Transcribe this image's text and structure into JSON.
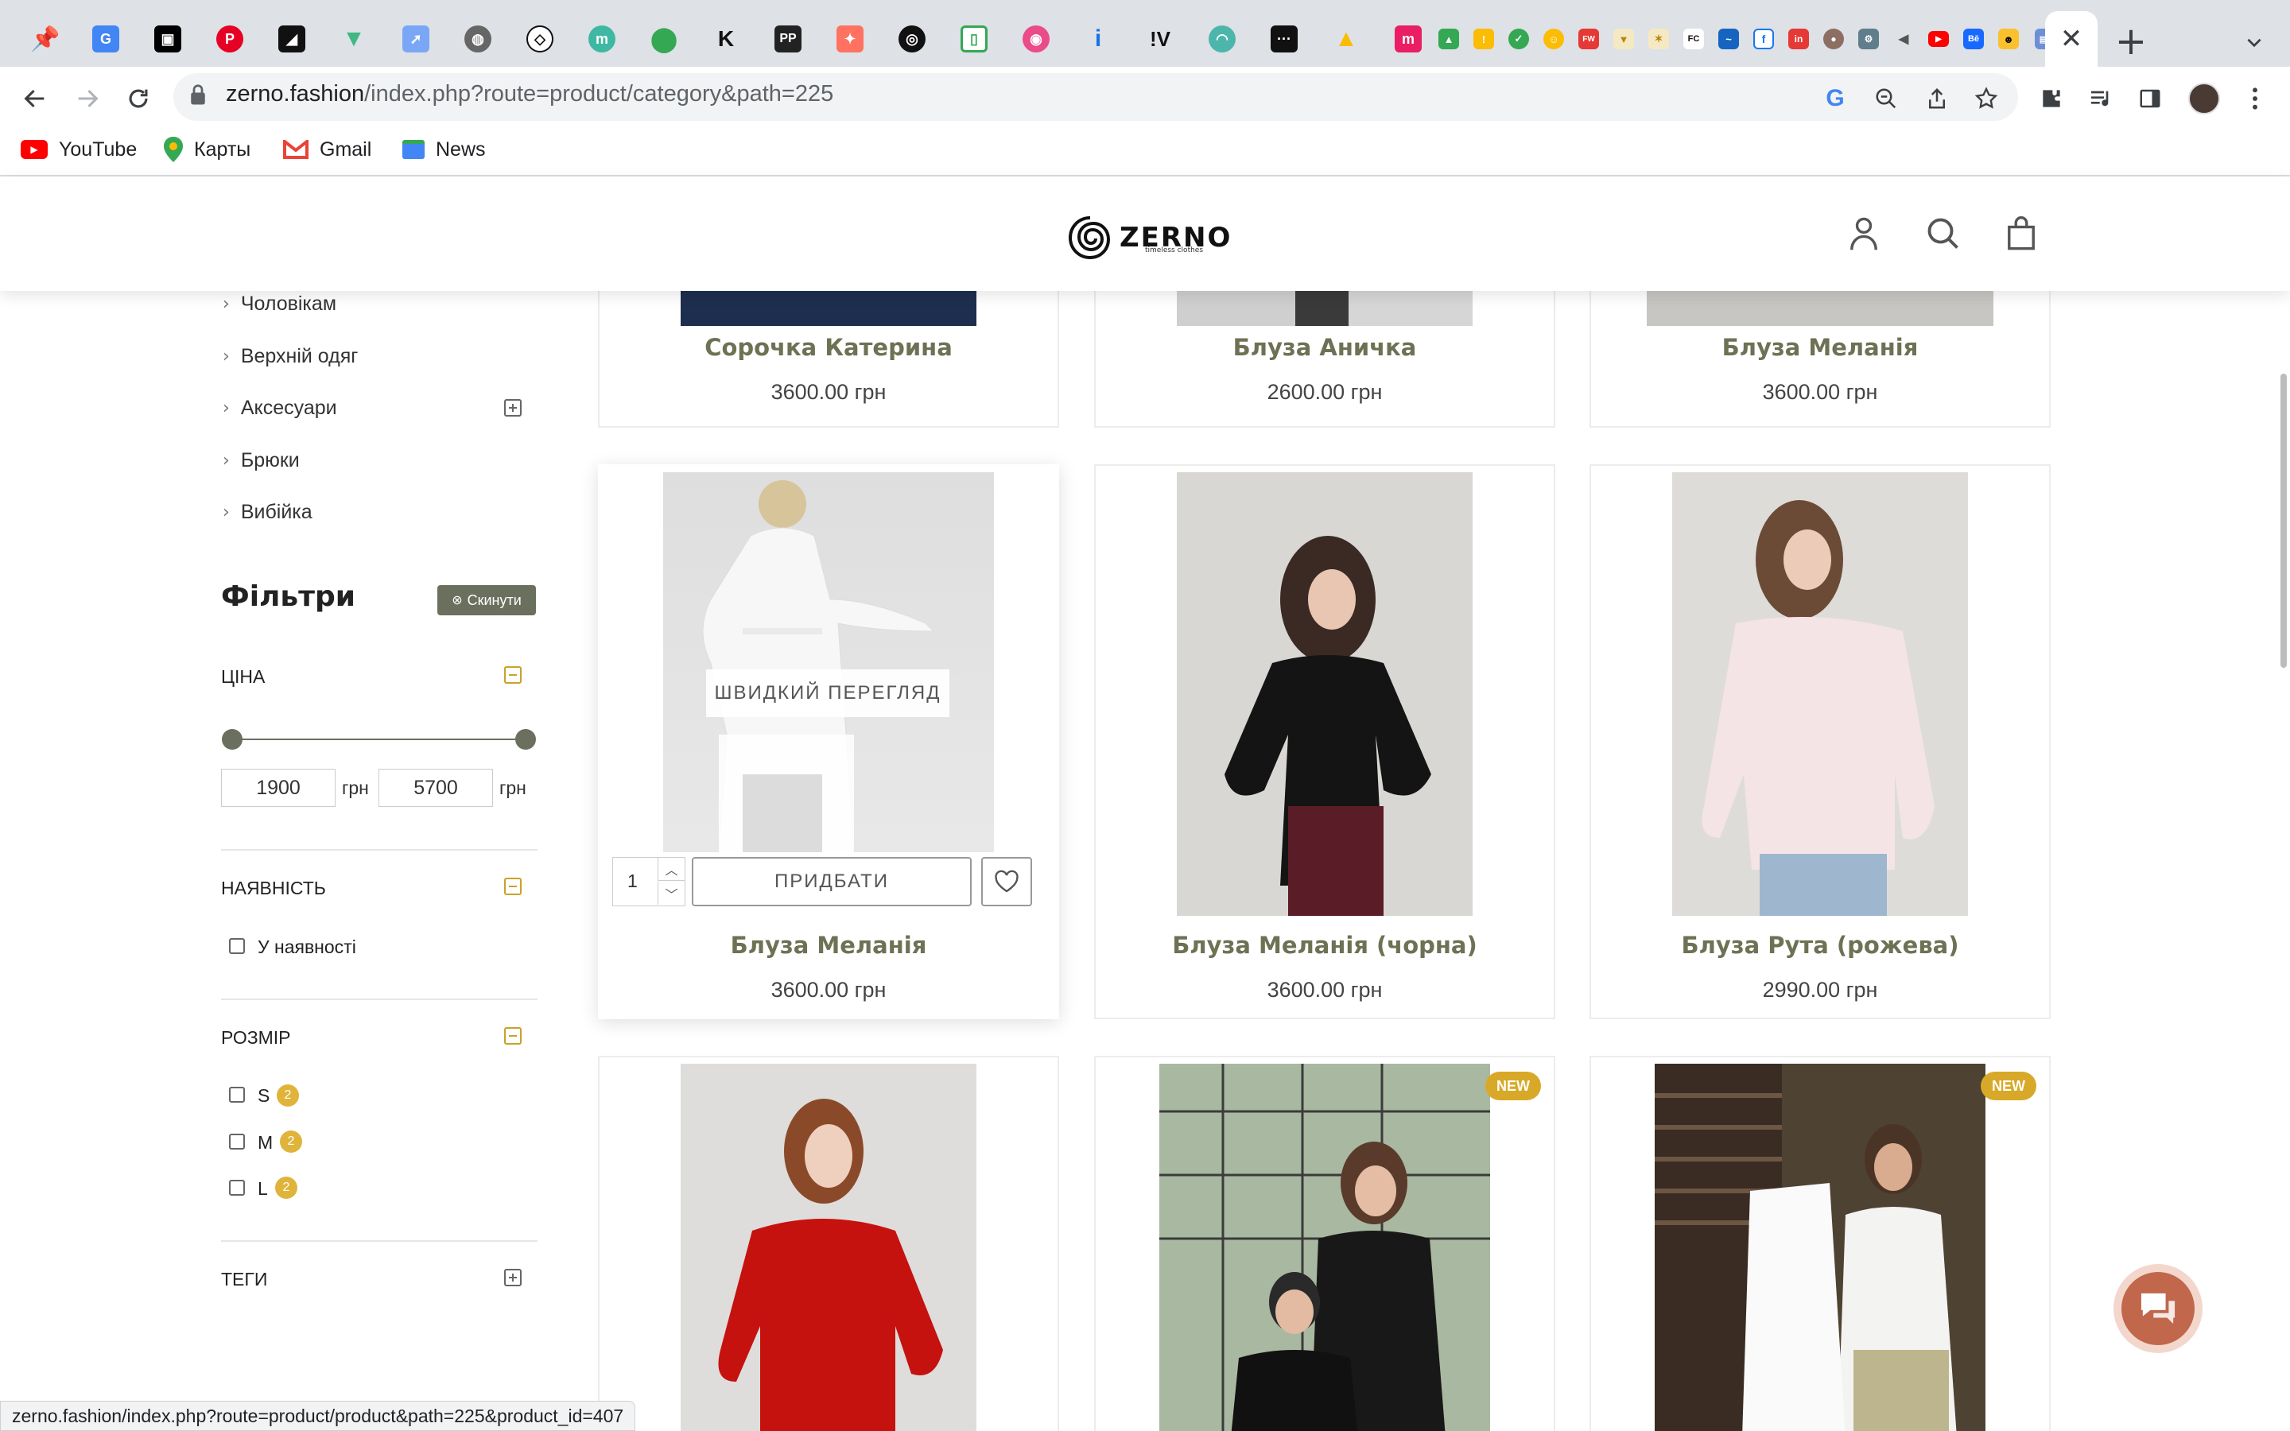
{
  "browser": {
    "url_host": "zerno.fashion",
    "url_path": "/index.php?route=product/category&path=225",
    "bookmarks": [
      "YouTube",
      "Карты",
      "Gmail",
      "News"
    ],
    "status_url": "zerno.fashion/index.php?route=product/product&path=225&product_id=407",
    "tab_icons": [
      "pin-icon",
      "translate-icon",
      "unsplash-icon",
      "pinterest-icon",
      "notion-icon",
      "vue-icon",
      "arrow-icon",
      "globe-icon",
      "codepen-icon",
      "miro-icon",
      "maps-icon",
      "k-icon",
      "pp-icon",
      "figma-icon",
      "spiral-icon",
      "phone-icon",
      "dribbble-icon",
      "info-icon",
      "v-icon",
      "ai-icon",
      "dots-icon",
      "drive-icon",
      "m-icon",
      "drive2-icon",
      "note-icon",
      "check-icon",
      "smile-icon",
      "fw-icon",
      "shield-icon",
      "star-icon",
      "fc-icon",
      "hand-icon",
      "facebook-icon",
      "in-icon",
      "person-icon",
      "tools-icon",
      "sound-icon",
      "youtube-icon",
      "behance-icon",
      "robot-icon",
      "page-icon",
      "sb-icon",
      "a-icon",
      "spark-icon",
      "blue-icon"
    ]
  },
  "site": {
    "logo_text": "ZERNO",
    "logo_sub": "timeless clothes",
    "categories": [
      {
        "label": "Чоловікам",
        "expandable": false
      },
      {
        "label": "Верхній одяг",
        "expandable": false
      },
      {
        "label": "Аксесуари",
        "expandable": true
      },
      {
        "label": "Брюки",
        "expandable": false
      },
      {
        "label": "Вибійка",
        "expandable": false
      }
    ],
    "filters": {
      "title": "Фільтри",
      "reset_label": "Скинути",
      "price": {
        "title": "ЦІНА",
        "min": "1900",
        "max": "5700",
        "unit": "грн"
      },
      "availability": {
        "title": "НАЯВНІСТЬ",
        "option": "У наявності"
      },
      "size": {
        "title": "РОЗМІР",
        "options": [
          {
            "label": "S",
            "count": "2"
          },
          {
            "label": "M",
            "count": "2"
          },
          {
            "label": "L",
            "count": "2"
          }
        ]
      },
      "tags": {
        "title": "ТЕГИ"
      }
    },
    "products": [
      {
        "name": "Сорочка Катерина",
        "price": "3600.00 грн"
      },
      {
        "name": "Блуза Аничка",
        "price": "2600.00 грн"
      },
      {
        "name": "Блуза Меланія",
        "price": "3600.00 грн"
      },
      {
        "name": "Блуза Меланія",
        "price": "3600.00 грн"
      },
      {
        "name": "Блуза Меланія (чорна)",
        "price": "3600.00 грн"
      },
      {
        "name": "Блуза Рута (рожева)",
        "price": "2990.00 грн"
      }
    ],
    "quick_view": "ШВИДКИЙ ПЕРЕГЛЯД",
    "add_to_cart": "ПРИДБАТИ",
    "qty": "1",
    "new_badge": "NEW"
  },
  "colors": {
    "accent": "#6e7153",
    "badge": "#d8a928",
    "chat": "#c0674c"
  }
}
